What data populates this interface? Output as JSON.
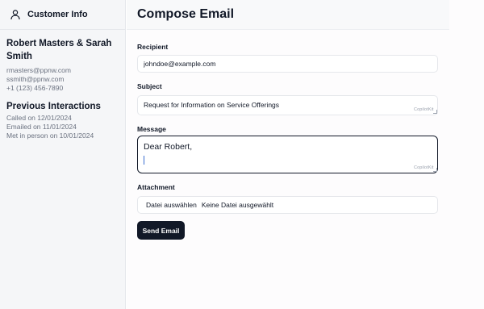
{
  "sidebar": {
    "title": "Customer Info",
    "header_icon": "user-icon",
    "contact": {
      "name": "Robert Masters & Sarah Smith",
      "emails": [
        "rmasters@ppnw.com",
        "ssmith@ppnw.com"
      ],
      "phone": "+1 (123) 456-7890"
    },
    "interactions": {
      "title": "Previous Interactions",
      "items": [
        "Called on 12/01/2024",
        "Emailed on 11/01/2024",
        "Met in person on 10/01/2024"
      ]
    }
  },
  "compose": {
    "title": "Compose Email",
    "recipient": {
      "label": "Recipient",
      "value": "johndoe@example.com"
    },
    "subject": {
      "label": "Subject",
      "value": "Request for Information on Service Offerings",
      "badge": "CopilotKit"
    },
    "message": {
      "label": "Message",
      "value": "Dear Robert,",
      "badge": "CopilotKit"
    },
    "attachment": {
      "label": "Attachment",
      "button_label": "Datei auswählen",
      "status": "Keine Datei ausgewählt"
    },
    "send_label": "Send Email"
  },
  "colors": {
    "primary_button": "#111827",
    "sidebar_bg": "#f5f6f8",
    "caret": "#3b6fd1"
  }
}
